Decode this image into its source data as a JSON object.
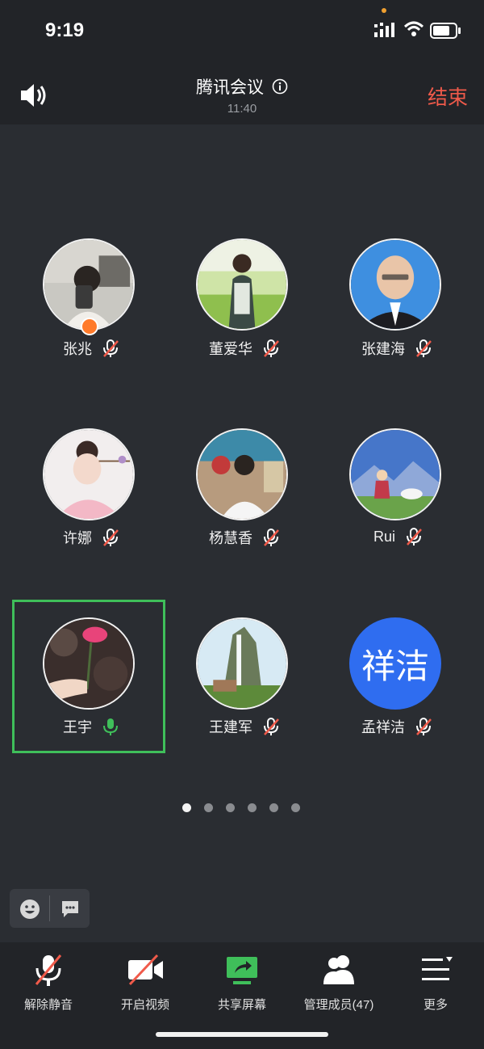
{
  "status": {
    "time": "9:19"
  },
  "header": {
    "title": "腾讯会议",
    "duration": "11:40",
    "end_label": "结束"
  },
  "participants": [
    {
      "name": "张兆",
      "mic": "muted",
      "host": true
    },
    {
      "name": "董爱华",
      "mic": "muted"
    },
    {
      "name": "张建海",
      "mic": "muted"
    },
    {
      "name": "许娜",
      "mic": "muted"
    },
    {
      "name": "杨慧香",
      "mic": "muted"
    },
    {
      "name": "Rui",
      "mic": "muted"
    },
    {
      "name": "王宇",
      "mic": "on",
      "speaking": true
    },
    {
      "name": "王建军",
      "mic": "muted"
    },
    {
      "name": "孟祥洁",
      "mic": "muted",
      "avatar_text": "祥洁"
    }
  ],
  "pagination": {
    "pages": 6,
    "current": 1
  },
  "toolbar": {
    "unmute": "解除静音",
    "video": "开启视频",
    "share": "共享屏幕",
    "members": "管理成员(47)",
    "more": "更多"
  },
  "colors": {
    "end": "#f05a4a",
    "active": "#3fbf5a",
    "share": "#3fbf5a",
    "avatar_blue": "#2f6df0"
  },
  "icons": [
    "speaker-icon",
    "info-icon",
    "mic-muted-icon",
    "mic-icon",
    "video-off-icon",
    "share-screen-icon",
    "members-icon",
    "more-icon",
    "emoji-icon",
    "chat-icon"
  ]
}
